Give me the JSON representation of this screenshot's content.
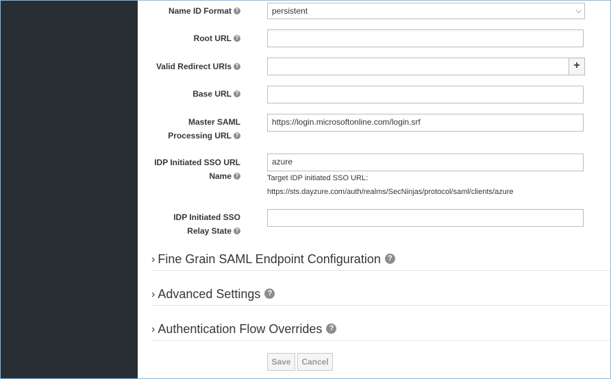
{
  "form": {
    "name_id_format": {
      "label": "Name ID Format",
      "value": "persistent"
    },
    "root_url": {
      "label": "Root URL",
      "value": ""
    },
    "valid_redirect_uris": {
      "label": "Valid Redirect URIs",
      "value": "",
      "add_label": "+"
    },
    "base_url": {
      "label": "Base URL",
      "value": ""
    },
    "master_saml": {
      "label_line1": "Master SAML",
      "label_line2": "Processing URL",
      "value": "https://login.microsoftonline.com/login.srf"
    },
    "idp_sso_url_name": {
      "label_line1": "IDP Initiated SSO URL",
      "label_line2": "Name",
      "value": "azure",
      "hint_line1": "Target IDP initiated SSO URL:",
      "hint_line2": "https://sts.dayzure.com/auth/realms/SecNinjas/protocol/saml/clients/azure"
    },
    "idp_relay_state": {
      "label_line1": "IDP Initiated SSO",
      "label_line2": "Relay State",
      "value": ""
    }
  },
  "sections": [
    {
      "title": "Fine Grain SAML Endpoint Configuration",
      "arrow": "›"
    },
    {
      "title": "Advanced Settings",
      "arrow": "›"
    },
    {
      "title": "Authentication Flow Overrides",
      "arrow": "›"
    }
  ],
  "actions": {
    "save_label": "Save",
    "cancel_label": "Cancel"
  },
  "help_glyph": "?",
  "colors": {
    "sidebar": "#292e34",
    "border": "#bbbbbb",
    "text": "#363636"
  }
}
